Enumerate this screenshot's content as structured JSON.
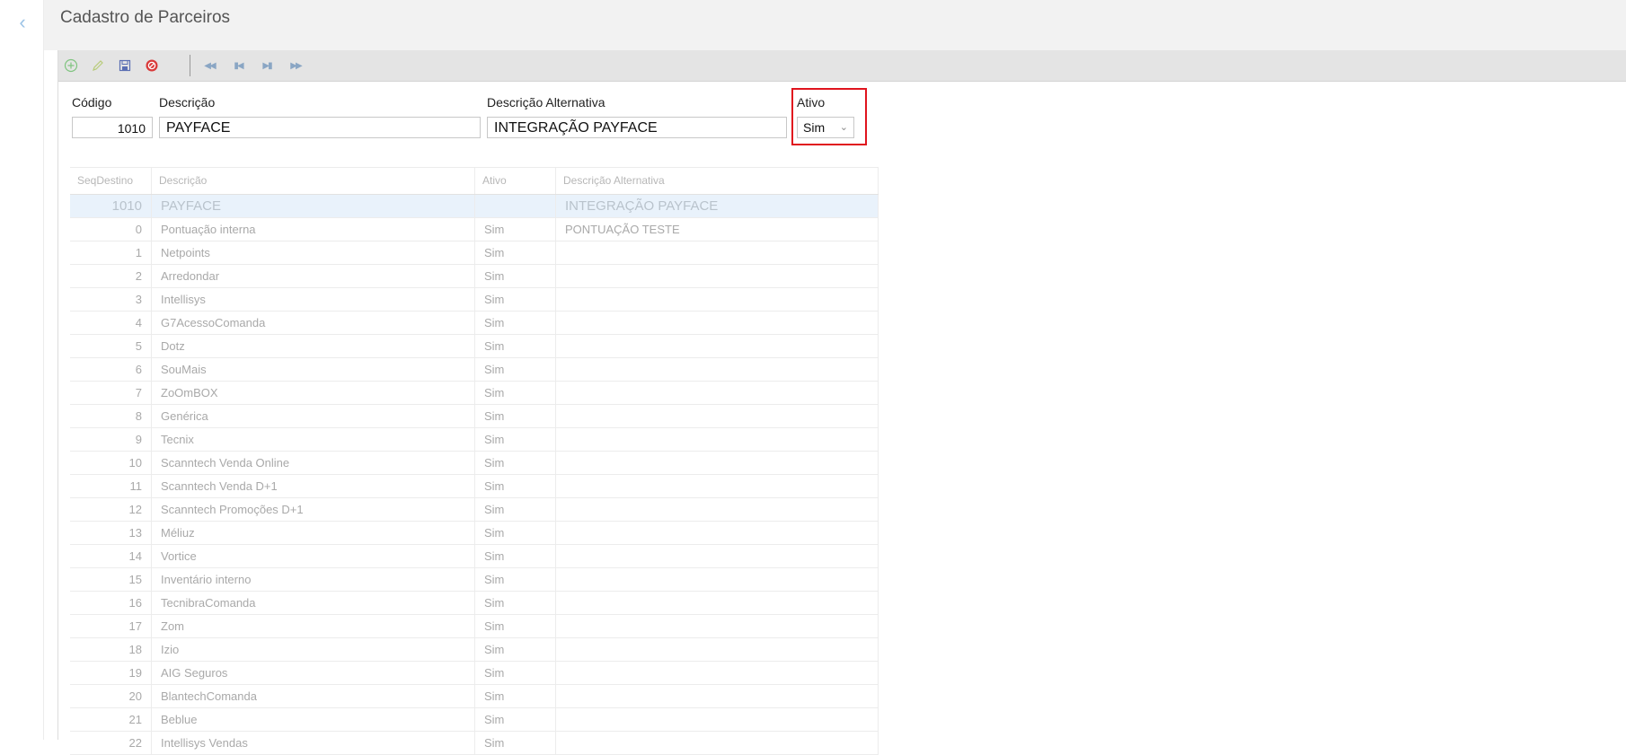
{
  "page": {
    "title": "Cadastro de Parceiros"
  },
  "toolbar": {
    "buttons": [
      {
        "name": "add-icon"
      },
      {
        "name": "edit-icon"
      },
      {
        "name": "save-icon"
      },
      {
        "name": "cancel-icon"
      },
      {
        "name": "first-record-icon"
      },
      {
        "name": "previous-record-icon"
      },
      {
        "name": "next-record-icon"
      },
      {
        "name": "last-record-icon"
      }
    ]
  },
  "form": {
    "codigo_label": "Código",
    "codigo_value": "1010",
    "descricao_label": "Descrição",
    "descricao_value": "PAYFACE",
    "descricao_alt_label": "Descrição Alternativa",
    "descricao_alt_value": "INTEGRAÇÃO PAYFACE",
    "ativo_label": "Ativo",
    "ativo_value": "Sim"
  },
  "grid": {
    "headers": [
      "SeqDestino",
      "Descrição",
      "Ativo",
      "Descrição Alternativa"
    ],
    "rows": [
      {
        "seq": "1010",
        "desc": "PAYFACE",
        "ativo": "",
        "alt": "INTEGRAÇÃO PAYFACE",
        "selected": true
      },
      {
        "seq": "0",
        "desc": "Pontuação interna",
        "ativo": "Sim",
        "alt": "PONTUAÇÃO TESTE"
      },
      {
        "seq": "1",
        "desc": "Netpoints",
        "ativo": "Sim",
        "alt": ""
      },
      {
        "seq": "2",
        "desc": "Arredondar",
        "ativo": "Sim",
        "alt": ""
      },
      {
        "seq": "3",
        "desc": "Intellisys",
        "ativo": "Sim",
        "alt": ""
      },
      {
        "seq": "4",
        "desc": "G7AcessoComanda",
        "ativo": "Sim",
        "alt": ""
      },
      {
        "seq": "5",
        "desc": "Dotz",
        "ativo": "Sim",
        "alt": ""
      },
      {
        "seq": "6",
        "desc": "SouMais",
        "ativo": "Sim",
        "alt": ""
      },
      {
        "seq": "7",
        "desc": "ZoOmBOX",
        "ativo": "Sim",
        "alt": ""
      },
      {
        "seq": "8",
        "desc": "Genérica",
        "ativo": "Sim",
        "alt": ""
      },
      {
        "seq": "9",
        "desc": "Tecnix",
        "ativo": "Sim",
        "alt": ""
      },
      {
        "seq": "10",
        "desc": "Scanntech Venda Online",
        "ativo": "Sim",
        "alt": ""
      },
      {
        "seq": "11",
        "desc": "Scanntech Venda D+1",
        "ativo": "Sim",
        "alt": ""
      },
      {
        "seq": "12",
        "desc": "Scanntech Promoções D+1",
        "ativo": "Sim",
        "alt": ""
      },
      {
        "seq": "13",
        "desc": "Méliuz",
        "ativo": "Sim",
        "alt": ""
      },
      {
        "seq": "14",
        "desc": "Vortice",
        "ativo": "Sim",
        "alt": ""
      },
      {
        "seq": "15",
        "desc": "Inventário interno",
        "ativo": "Sim",
        "alt": ""
      },
      {
        "seq": "16",
        "desc": "TecnibraComanda",
        "ativo": "Sim",
        "alt": ""
      },
      {
        "seq": "17",
        "desc": "Zom",
        "ativo": "Sim",
        "alt": ""
      },
      {
        "seq": "18",
        "desc": "Izio",
        "ativo": "Sim",
        "alt": ""
      },
      {
        "seq": "19",
        "desc": "AIG Seguros",
        "ativo": "Sim",
        "alt": ""
      },
      {
        "seq": "20",
        "desc": "BlantechComanda",
        "ativo": "Sim",
        "alt": ""
      },
      {
        "seq": "21",
        "desc": "Beblue",
        "ativo": "Sim",
        "alt": ""
      },
      {
        "seq": "22",
        "desc": "Intellisys Vendas",
        "ativo": "Sim",
        "alt": ""
      }
    ]
  },
  "colors": {
    "highlight": "#e0141e",
    "selected_row": "#e9f2fb",
    "toolbar": "#e4e4e4"
  }
}
